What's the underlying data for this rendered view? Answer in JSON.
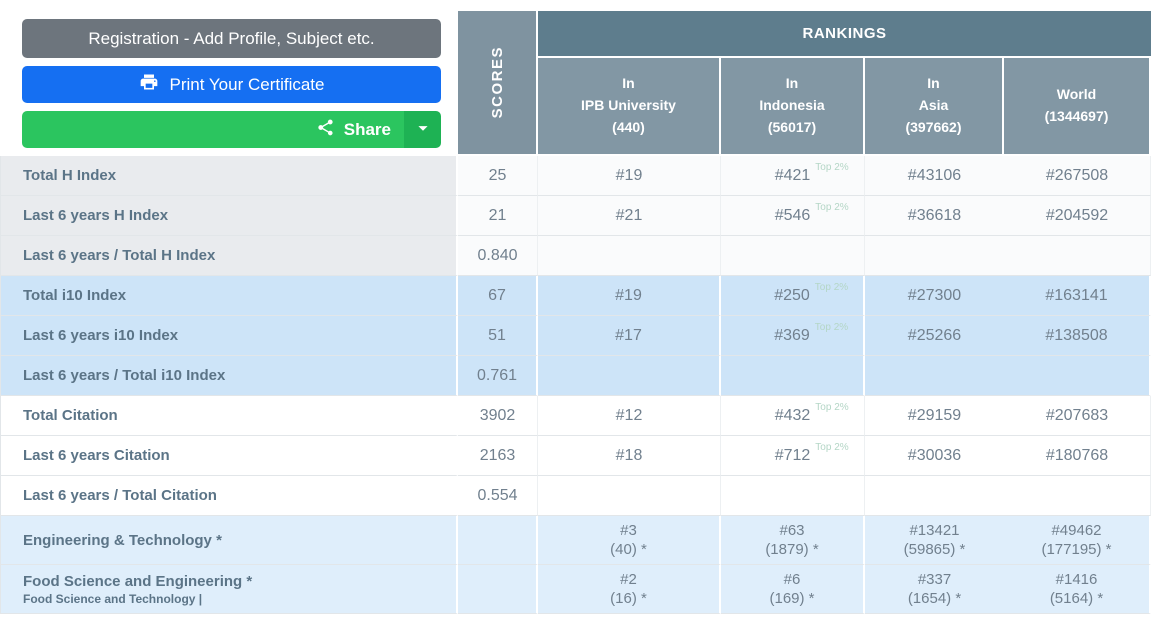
{
  "buttons": {
    "registration_label": "Registration - Add Profile, Subject etc.",
    "print_label": "Print Your Certificate",
    "share_label": "Share"
  },
  "colors": {
    "registration_button": "#6d757d",
    "print_button": "#156ff2",
    "share_button": "#2bc55f",
    "share_dropdown": "#1eb254",
    "rankings_header_bg": "#5e7d8d",
    "column_header_bg": "#8297a4",
    "scores_header_bg": "#7f93a0",
    "row_blue": "#cde4f8",
    "row_blue_light": "#dfeefb",
    "row_gray_label": "#e9ebee",
    "top_badge_text": "#b4d6c6"
  },
  "table": {
    "scores_header": "SCORES",
    "rankings_header": "RANKINGS",
    "columns": [
      {
        "l1": "In",
        "l2": "IPB University",
        "l3": "(440)"
      },
      {
        "l1": "In",
        "l2": "Indonesia",
        "l3": "(56017)"
      },
      {
        "l1": "In",
        "l2": "Asia",
        "l3": "(397662)"
      },
      {
        "l1": "World",
        "l2": "(1344697)",
        "l3": ""
      }
    ],
    "rows": [
      {
        "label": "Total H Index",
        "score": "25",
        "ipb": "#19",
        "idn": "#421",
        "idn_badge": "Top 2%",
        "asia": "#43106",
        "world": "#267508"
      },
      {
        "label": "Last 6 years H Index",
        "score": "21",
        "ipb": "#21",
        "idn": "#546",
        "idn_badge": "Top 2%",
        "asia": "#36618",
        "world": "#204592"
      },
      {
        "label": "Last 6 years / Total H Index",
        "score": "0.840",
        "ipb": "",
        "idn": "",
        "asia": "",
        "world": ""
      },
      {
        "label": "Total i10 Index",
        "score": "67",
        "ipb": "#19",
        "idn": "#250",
        "idn_badge": "Top 2%",
        "asia": "#27300",
        "world": "#163141"
      },
      {
        "label": "Last 6 years i10 Index",
        "score": "51",
        "ipb": "#17",
        "idn": "#369",
        "idn_badge": "Top 2%",
        "asia": "#25266",
        "world": "#138508"
      },
      {
        "label": "Last 6 years / Total i10 Index",
        "score": "0.761",
        "ipb": "",
        "idn": "",
        "asia": "",
        "world": ""
      },
      {
        "label": "Total Citation",
        "score": "3902",
        "ipb": "#12",
        "idn": "#432",
        "idn_badge": "Top 2%",
        "asia": "#29159",
        "world": "#207683"
      },
      {
        "label": "Last 6 years Citation",
        "score": "2163",
        "ipb": "#18",
        "idn": "#712",
        "idn_badge": "Top 2%",
        "asia": "#30036",
        "world": "#180768"
      },
      {
        "label": "Last 6 years / Total Citation",
        "score": "0.554",
        "ipb": "",
        "idn": "",
        "asia": "",
        "world": ""
      },
      {
        "label": "Engineering & Technology *",
        "score": "",
        "ipb": "#3",
        "ipb2": "(40) *",
        "idn": "#63",
        "idn2": "(1879) *",
        "asia": "#13421",
        "asia2": "(59865) *",
        "world": "#49462",
        "world2": "(177195) *"
      },
      {
        "label": "Food Science and Engineering *",
        "sublabel": "Food Science and Technology |",
        "score": "",
        "ipb": "#2",
        "ipb2": "(16) *",
        "idn": "#6",
        "idn2": "(169) *",
        "asia": "#337",
        "asia2": "(1654) *",
        "world": "#1416",
        "world2": "(5164) *"
      }
    ]
  }
}
